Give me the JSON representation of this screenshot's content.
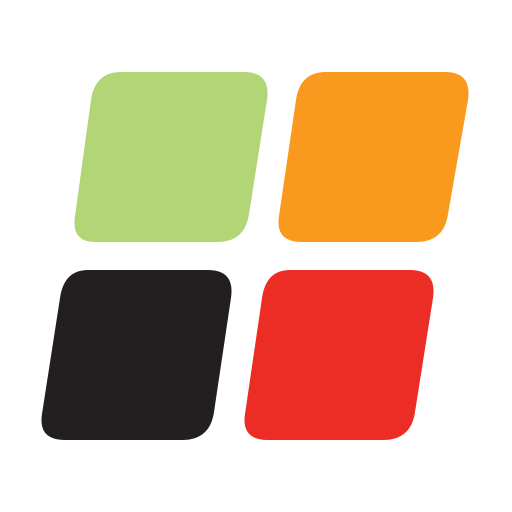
{
  "logo": {
    "tiles": [
      {
        "name": "green",
        "color": "#b2d675"
      },
      {
        "name": "orange",
        "color": "#f99a1e"
      },
      {
        "name": "black",
        "color": "#231f20"
      },
      {
        "name": "red",
        "color": "#ec2d26"
      }
    ],
    "background_color": "#ffffff"
  }
}
